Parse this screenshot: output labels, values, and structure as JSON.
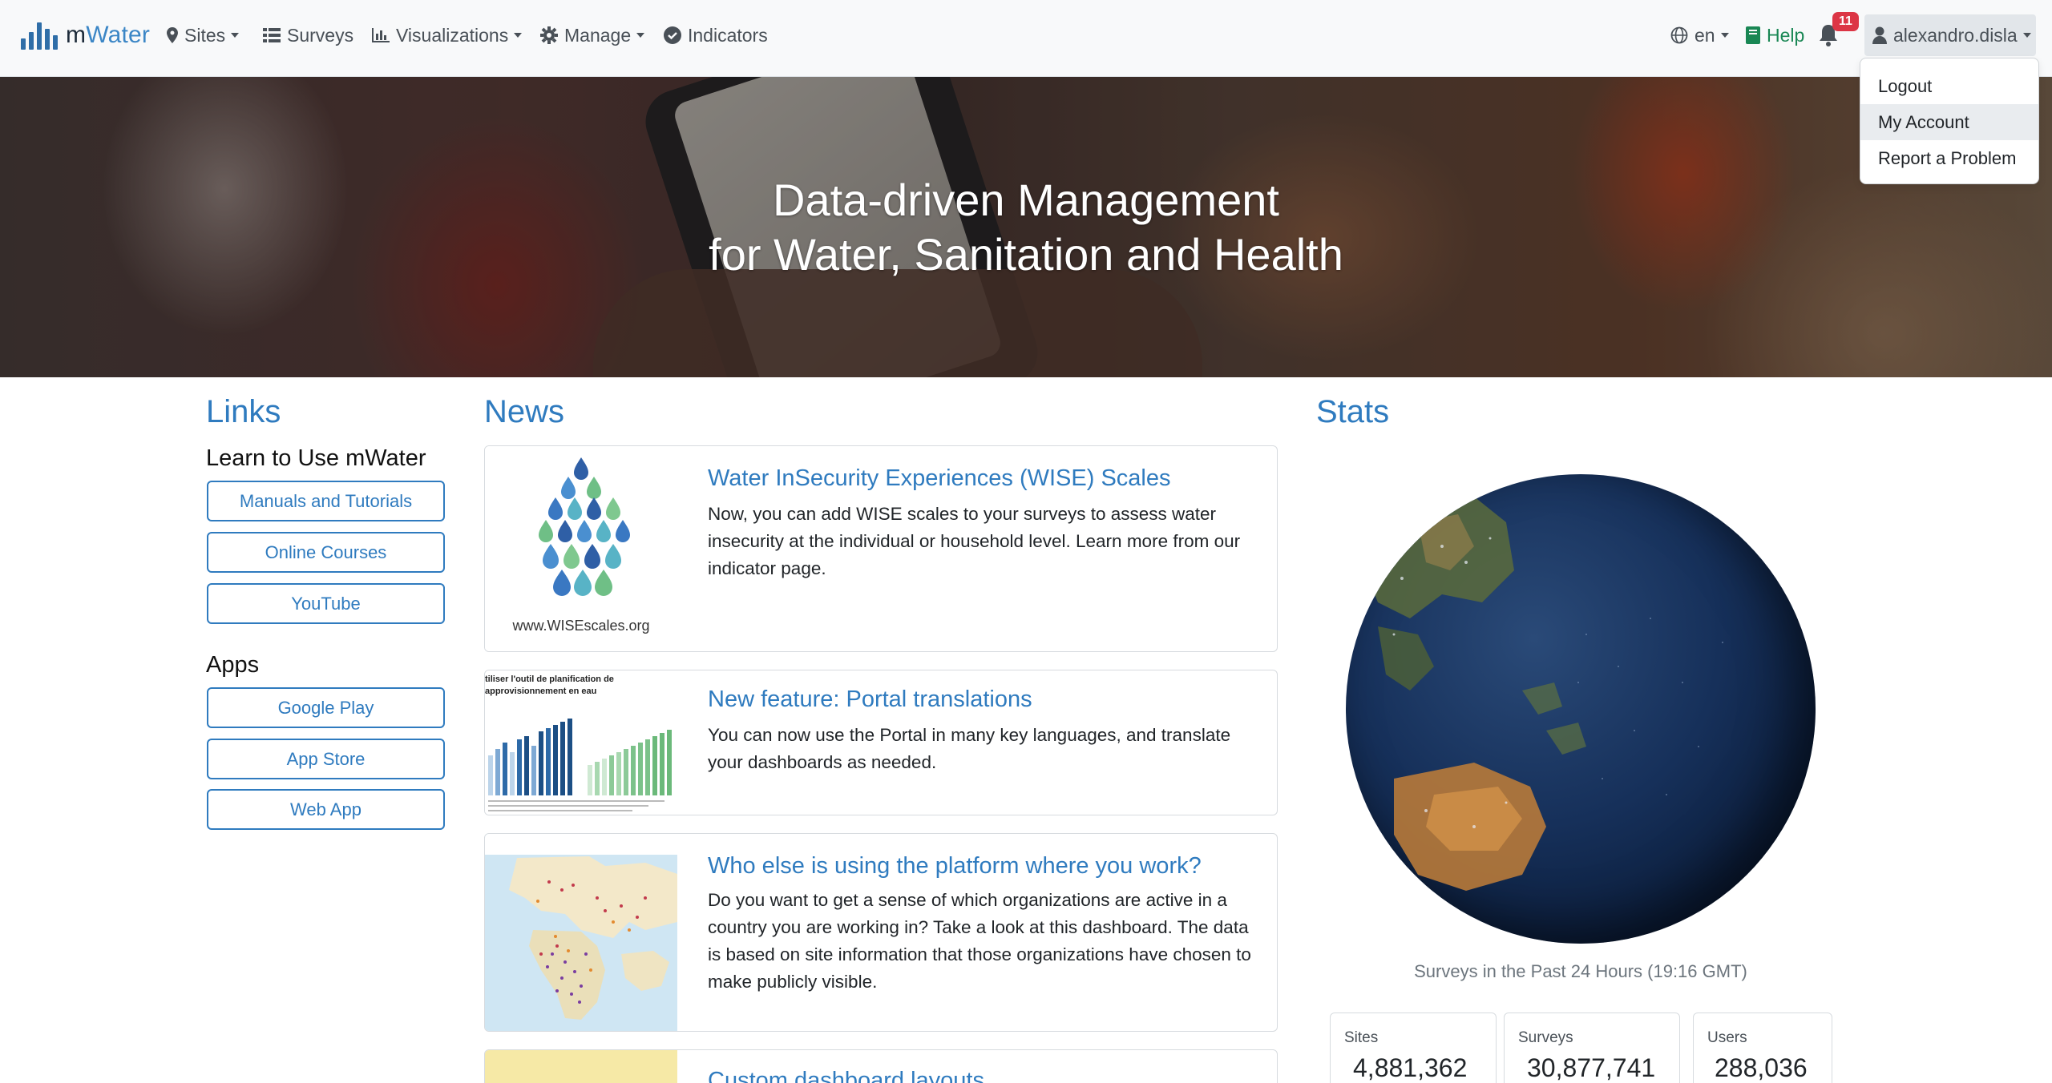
{
  "brand": {
    "name_part1": "m",
    "name_part2": "Water"
  },
  "nav": {
    "sites": "Sites",
    "surveys": "Surveys",
    "visualizations": "Visualizations",
    "manage": "Manage",
    "indicators": "Indicators",
    "language": "en",
    "help": "Help",
    "notification_count": "11",
    "user": "alexandro.disla"
  },
  "user_menu": {
    "items": [
      "Logout",
      "My Account",
      "Report a Problem"
    ],
    "highlighted": "My Account"
  },
  "hero": {
    "line1": "Data-driven Management",
    "line2": "for Water, Sanitation and Health"
  },
  "links": {
    "title": "Links",
    "learn_heading": "Learn to Use mWater",
    "learn_buttons": [
      "Manuals and Tutorials",
      "Online Courses",
      "YouTube"
    ],
    "apps_heading": "Apps",
    "app_buttons": [
      "Google Play",
      "App Store",
      "Web App"
    ]
  },
  "news": {
    "title": "News",
    "items": [
      {
        "title": "Water InSecurity Experiences (WISE) Scales",
        "body": "Now, you can add WISE scales to your surveys to assess water insecurity at the individual or household level. Learn more from our indicator page.",
        "thumb_caption": "www.WISEscales.org"
      },
      {
        "title": "New feature: Portal translations",
        "body": "You can now use the Portal in many key languages, and translate your dashboards as needed.",
        "thumb_caption_line1": "tiliser l'outil de planification de",
        "thumb_caption_line2": "approvisionnement en eau"
      },
      {
        "title": "Who else is using the platform where you work?",
        "body": "Do you want to get a sense of which organizations are active in a country you are working in? Take a look at this dashboard. The data is based on site information that those organizations have chosen to make publicly visible."
      },
      {
        "title": "Custom dashboard layouts"
      }
    ]
  },
  "stats": {
    "title": "Stats",
    "globe_caption": "Surveys in the Past 24 Hours (19:16 GMT)",
    "cards": [
      {
        "label": "Sites",
        "value": "4,881,362"
      },
      {
        "label": "Surveys",
        "value": "30,877,741"
      },
      {
        "label": "Users",
        "value": "288,036"
      }
    ]
  },
  "colors": {
    "brand_blue": "#2f7bbf",
    "help_green": "#198754",
    "badge_red": "#dc3545"
  }
}
